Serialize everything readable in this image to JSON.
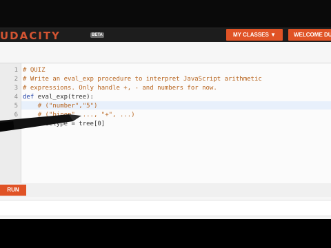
{
  "header": {
    "logo_text": "UDACITY",
    "beta_label": "BETA",
    "my_classes_label": "MY CLASSES ▼",
    "welcome_label": "WELCOME DU"
  },
  "editor": {
    "line_numbers": [
      "1",
      "2",
      "3",
      "4",
      "5",
      "6",
      "7"
    ],
    "lines": [
      "# QUIZ",
      "# Write an eval_exp procedure to interpret JavaScript arithmetic",
      "# expressions. Only handle +, - and numbers for now.",
      "def eval_exp(tree):",
      "    # (\"number\",\"5\")",
      "    # (\"binop\", ..., \"+\", ...)",
      "    nodetype = tree[0]"
    ],
    "line4_def": "def",
    "line4_rest": " eval_exp(tree):",
    "line5_indent": "    ",
    "line5_comment": "# (\"number\",\"5\")",
    "line6_indent": "    ",
    "line6_comment": "# (\"binop\", ..., \"+\", ...)",
    "line7": "    nodetype = tree[0]"
  },
  "run_button_label": "RUN",
  "colors": {
    "accent": "#e05326",
    "comment": "#b8651f",
    "keyword": "#1f3fa7"
  }
}
